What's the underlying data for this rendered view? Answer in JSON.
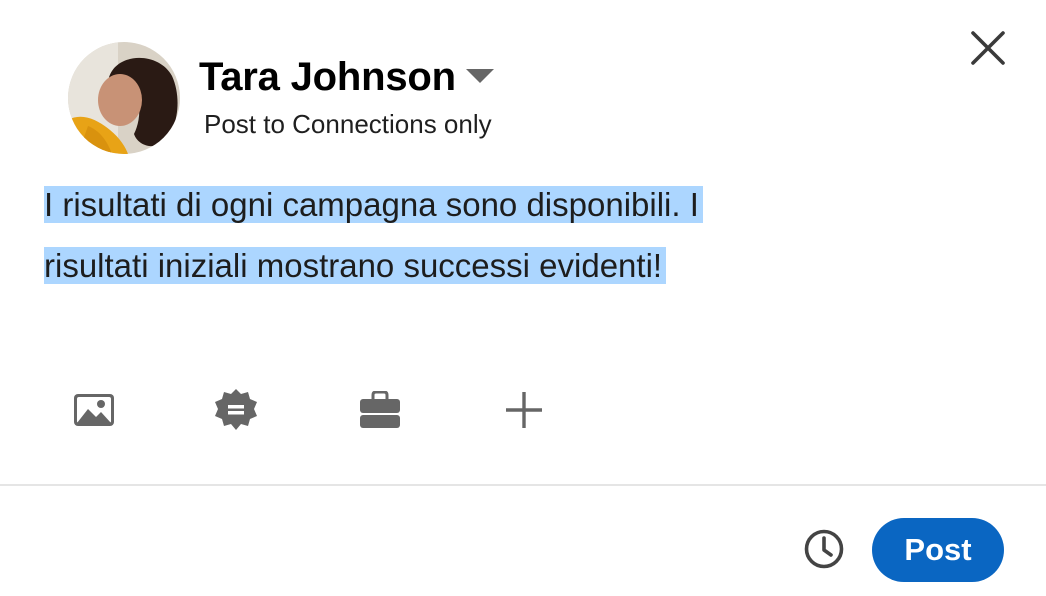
{
  "author": {
    "name": "Tara Johnson",
    "avatar_icon": "user-avatar-photo"
  },
  "audience": {
    "label": "Post to Connections only"
  },
  "editor": {
    "line1": "I risultati di ogni campagna sono disponibili. I",
    "line2": "risultati iniziali mostrano successi evidenti!",
    "selection_color": "#acd6ff"
  },
  "toolbar": {
    "items": [
      {
        "icon": "image-icon"
      },
      {
        "icon": "celebrate-badge-icon"
      },
      {
        "icon": "briefcase-icon"
      },
      {
        "icon": "plus-icon"
      }
    ]
  },
  "footer": {
    "schedule_icon": "clock-icon",
    "post_label": "Post"
  },
  "colors": {
    "accent": "#0a66c2",
    "icon": "#666666",
    "text": "#000000"
  }
}
